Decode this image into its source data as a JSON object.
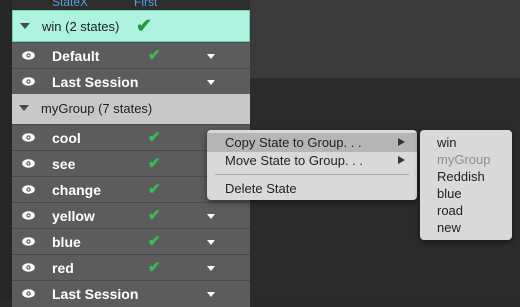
{
  "header": {
    "col_state": "StateX",
    "col_first": "First"
  },
  "groups": [
    {
      "title": "win  (2 states)",
      "checked": true,
      "states": [
        {
          "label": "Default",
          "checked": true,
          "has_caret": true
        },
        {
          "label": "Last Session",
          "checked": false,
          "has_caret": true
        }
      ]
    },
    {
      "title": "myGroup  (7 states)",
      "checked": false,
      "states": [
        {
          "label": "cool",
          "checked": true,
          "has_caret": false
        },
        {
          "label": "see",
          "checked": true,
          "has_caret": false
        },
        {
          "label": "change",
          "checked": true,
          "has_caret": false
        },
        {
          "label": "yellow",
          "checked": true,
          "has_caret": true
        },
        {
          "label": "blue",
          "checked": true,
          "has_caret": true
        },
        {
          "label": "red",
          "checked": true,
          "has_caret": true
        },
        {
          "label": "Last Session",
          "checked": false,
          "has_caret": true
        }
      ]
    }
  ],
  "context_menu": {
    "items": [
      {
        "label": "Copy State to Group. . .",
        "has_submenu": true,
        "highlighted": true
      },
      {
        "label": "Move State to Group. . .",
        "has_submenu": true,
        "highlighted": false
      },
      {
        "label": "Delete State",
        "has_submenu": false,
        "highlighted": false
      }
    ]
  },
  "submenu": {
    "items": [
      {
        "label": "win",
        "disabled": false
      },
      {
        "label": "myGroup",
        "disabled": true
      },
      {
        "label": "Reddish",
        "disabled": false
      },
      {
        "label": "blue",
        "disabled": false
      },
      {
        "label": "road",
        "disabled": false
      },
      {
        "label": "new",
        "disabled": false
      }
    ]
  },
  "colors": {
    "accent_header": "#5a9fd6",
    "group_win_bg": "#aef3df",
    "check_green": "#34c24f"
  },
  "icons": {
    "visibility": "eye-icon",
    "checked": "check-icon",
    "expand": "disclosure-triangle-icon",
    "row_menu": "caret-down-icon",
    "submenu": "submenu-arrow-icon"
  }
}
